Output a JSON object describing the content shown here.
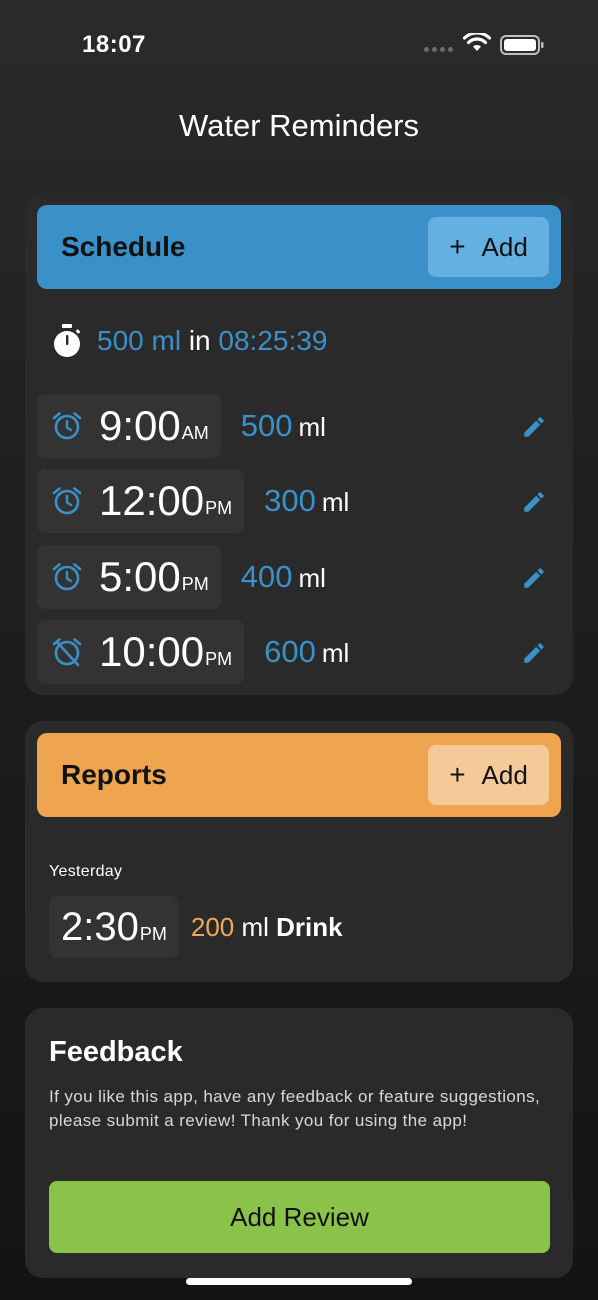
{
  "status_bar": {
    "time": "18:07"
  },
  "page_title": "Water Reminders",
  "schedule": {
    "title": "Schedule",
    "add_label": "Add",
    "next": {
      "amount": "500 ml",
      "in_word": "in",
      "countdown": "08:25:39"
    },
    "items": [
      {
        "time": "9:00",
        "ampm": "AM",
        "amount": "500",
        "unit": "ml",
        "alarm": "alarm-icon"
      },
      {
        "time": "12:00",
        "ampm": "PM",
        "amount": "300",
        "unit": "ml",
        "alarm": "alarm-icon"
      },
      {
        "time": "5:00",
        "ampm": "PM",
        "amount": "400",
        "unit": "ml",
        "alarm": "alarm-icon"
      },
      {
        "time": "10:00",
        "ampm": "PM",
        "amount": "600",
        "unit": "ml",
        "alarm": "alarm-off-icon"
      }
    ]
  },
  "reports": {
    "title": "Reports",
    "add_label": "Add",
    "date_label": "Yesterday",
    "entry": {
      "time": "2:30",
      "ampm": "PM",
      "amount": "200",
      "unit": "ml",
      "label": "Drink"
    }
  },
  "feedback": {
    "title": "Feedback",
    "text": "If you like this app, have any feedback or feature suggestions, please submit a review! Thank you for using the app!",
    "button_label": "Add Review"
  },
  "colors": {
    "schedule_accent": "#3a91c9",
    "reports_accent": "#efa54f",
    "review_button": "#8bc34a"
  }
}
